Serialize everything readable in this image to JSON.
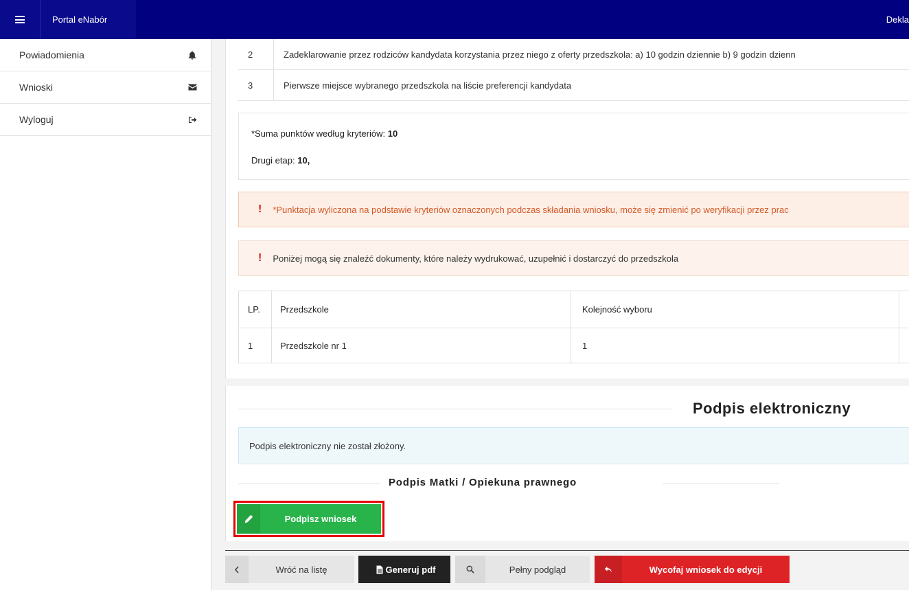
{
  "topbar": {
    "brand": "Portal eNabór",
    "right_text": "Dekla"
  },
  "sidebar": {
    "items": [
      {
        "label": "Powiadomienia",
        "icon": "bell-icon"
      },
      {
        "label": "Wnioski",
        "icon": "envelope-icon"
      },
      {
        "label": "Wyloguj",
        "icon": "sign-out-icon"
      }
    ]
  },
  "criteria": {
    "rows": [
      {
        "num": "2",
        "text": "Zadeklarowanie przez rodziców kandydata korzystania przez niego z oferty przedszkola: a) 10 godzin dziennie b) 9 godzin dzienn"
      },
      {
        "num": "3",
        "text": "Pierwsze miejsce wybranego przedszkola na liście preferencji kandydata"
      }
    ]
  },
  "summary": {
    "points_label": "*Suma punktów według kryteriów:",
    "points_value": "10",
    "stage_label": "Drugi etap:",
    "stage_value": "10,"
  },
  "alerts": {
    "scoring_note": "*Punktacja wyliczona na podstawie kryteriów oznaczonych podczas składania wniosku, może się zmienić po weryfikacji przez prac",
    "documents_note": "Poniżej mogą się znaleźć dokumenty, które należy wydrukować, uzupełnić i dostarczyć do przedszkola"
  },
  "preferences": {
    "headers": [
      "LP.",
      "Przedszkole",
      "Kolejność wyboru"
    ],
    "rows": [
      {
        "lp": "1",
        "name": "Przedszkole nr 1",
        "order": "1"
      }
    ]
  },
  "signature": {
    "title": "Podpis elektroniczny",
    "info": "Podpis elektroniczny nie został złożony.",
    "subtitle": "Podpis Matki / Opiekuna prawnego",
    "sign_button": "Podpisz wniosek"
  },
  "actions": {
    "back": "Wróć na listę",
    "pdf": "Generuj pdf",
    "preview": "Pełny podgląd",
    "withdraw": "Wycofaj wniosek do edycji"
  },
  "colors": {
    "topbar": "#010080",
    "sign_button": "#28b44a",
    "withdraw_button": "#de2327",
    "highlight_border": "#e60000"
  }
}
